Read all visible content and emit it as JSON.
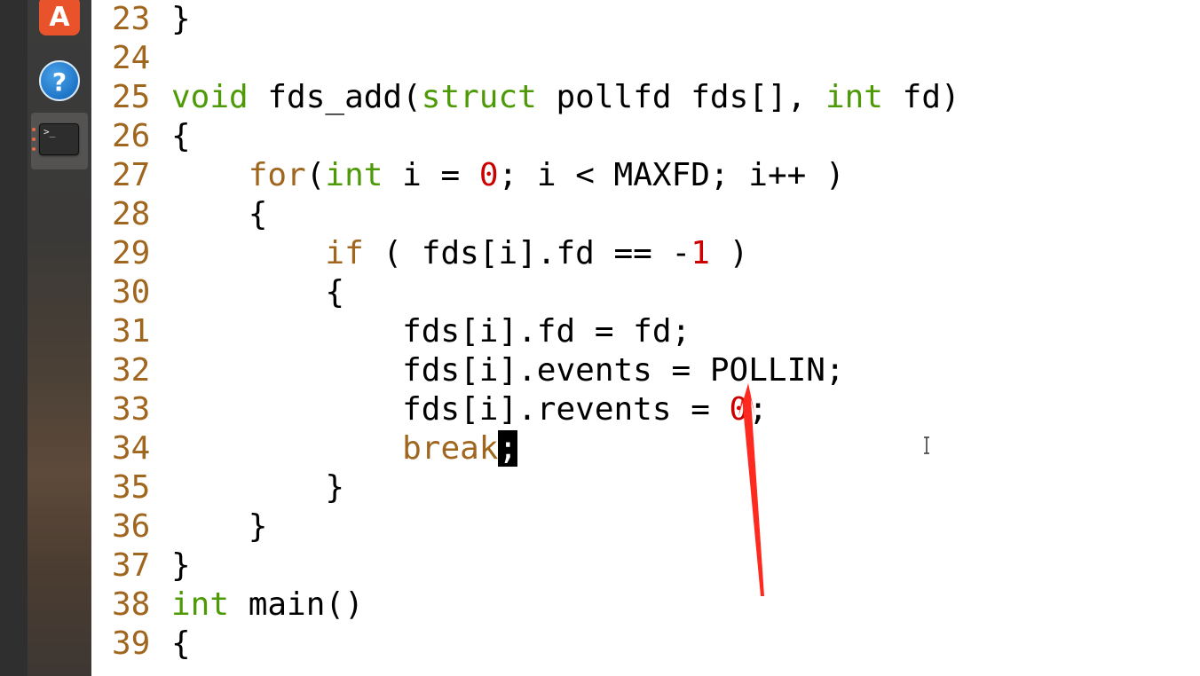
{
  "dock": {
    "items": [
      {
        "name": "Ubuntu Software",
        "icon": "software-center-icon",
        "glyph": "A"
      },
      {
        "name": "Help",
        "icon": "help-icon",
        "glyph": "?"
      },
      {
        "name": "Terminal",
        "icon": "terminal-icon",
        "glyph": ">_"
      }
    ]
  },
  "editor": {
    "lines": [
      {
        "num": "23",
        "tokens": [
          {
            "t": "}",
            "c": "plain"
          }
        ]
      },
      {
        "num": "24",
        "tokens": []
      },
      {
        "num": "25",
        "tokens": [
          {
            "t": "void",
            "c": "kw-green"
          },
          {
            "t": " fds_add(",
            "c": "plain"
          },
          {
            "t": "struct",
            "c": "kw-green"
          },
          {
            "t": " pollfd fds[], ",
            "c": "plain"
          },
          {
            "t": "int",
            "c": "kw-green"
          },
          {
            "t": " fd)",
            "c": "plain"
          }
        ]
      },
      {
        "num": "26",
        "tokens": [
          {
            "t": "{",
            "c": "plain"
          }
        ]
      },
      {
        "num": "27",
        "tokens": [
          {
            "t": "    ",
            "c": "plain"
          },
          {
            "t": "for",
            "c": "kw-brown"
          },
          {
            "t": "(",
            "c": "plain"
          },
          {
            "t": "int",
            "c": "kw-green"
          },
          {
            "t": " i = ",
            "c": "plain"
          },
          {
            "t": "0",
            "c": "num"
          },
          {
            "t": "; i < MAXFD; i++ )",
            "c": "plain"
          }
        ]
      },
      {
        "num": "28",
        "tokens": [
          {
            "t": "    {",
            "c": "plain"
          }
        ]
      },
      {
        "num": "29",
        "tokens": [
          {
            "t": "        ",
            "c": "plain"
          },
          {
            "t": "if",
            "c": "kw-brown"
          },
          {
            "t": " ( fds[i].fd == -",
            "c": "plain"
          },
          {
            "t": "1",
            "c": "num"
          },
          {
            "t": " )",
            "c": "plain"
          }
        ]
      },
      {
        "num": "30",
        "tokens": [
          {
            "t": "        {",
            "c": "plain"
          }
        ]
      },
      {
        "num": "31",
        "tokens": [
          {
            "t": "            fds[i].fd = fd;",
            "c": "plain"
          }
        ]
      },
      {
        "num": "32",
        "tokens": [
          {
            "t": "            fds[i].events = POLLIN;",
            "c": "plain"
          }
        ]
      },
      {
        "num": "33",
        "tokens": [
          {
            "t": "            fds[i].revents = ",
            "c": "plain"
          },
          {
            "t": "0",
            "c": "num"
          },
          {
            "t": ";",
            "c": "plain"
          }
        ]
      },
      {
        "num": "34",
        "tokens": [
          {
            "t": "            ",
            "c": "plain"
          },
          {
            "t": "break",
            "c": "kw-brown"
          },
          {
            "t": ";",
            "c": "cursor"
          }
        ]
      },
      {
        "num": "35",
        "tokens": [
          {
            "t": "        }",
            "c": "plain"
          }
        ]
      },
      {
        "num": "36",
        "tokens": [
          {
            "t": "    }",
            "c": "plain"
          }
        ]
      },
      {
        "num": "37",
        "tokens": [
          {
            "t": "}",
            "c": "plain"
          }
        ]
      },
      {
        "num": "38",
        "tokens": [
          {
            "t": "int",
            "c": "kw-green"
          },
          {
            "t": " main()",
            "c": "plain"
          }
        ]
      },
      {
        "num": "39",
        "tokens": [
          {
            "t": "{",
            "c": "plain"
          }
        ]
      }
    ]
  },
  "colors": {
    "line_number": "#a0661e",
    "type_keyword": "#4e9a06",
    "control_keyword": "#a0661e",
    "number_literal": "#cc0000",
    "annotation_arrow": "#ff2a1f"
  }
}
